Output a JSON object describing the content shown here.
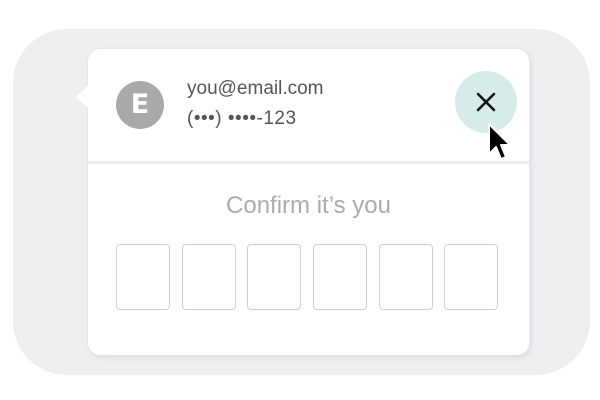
{
  "account": {
    "avatar_initial": "E",
    "email": "you@email.com",
    "phone_masked": "(•••) ••••-123"
  },
  "close_button": {
    "icon": "close-icon",
    "accent_color": "#d7ecea"
  },
  "verification": {
    "title": "Confirm it’s you",
    "code_length": 6
  },
  "colors": {
    "backdrop": "#eeeeef",
    "avatar": "#a9a9a9",
    "muted_text": "#ababab"
  }
}
